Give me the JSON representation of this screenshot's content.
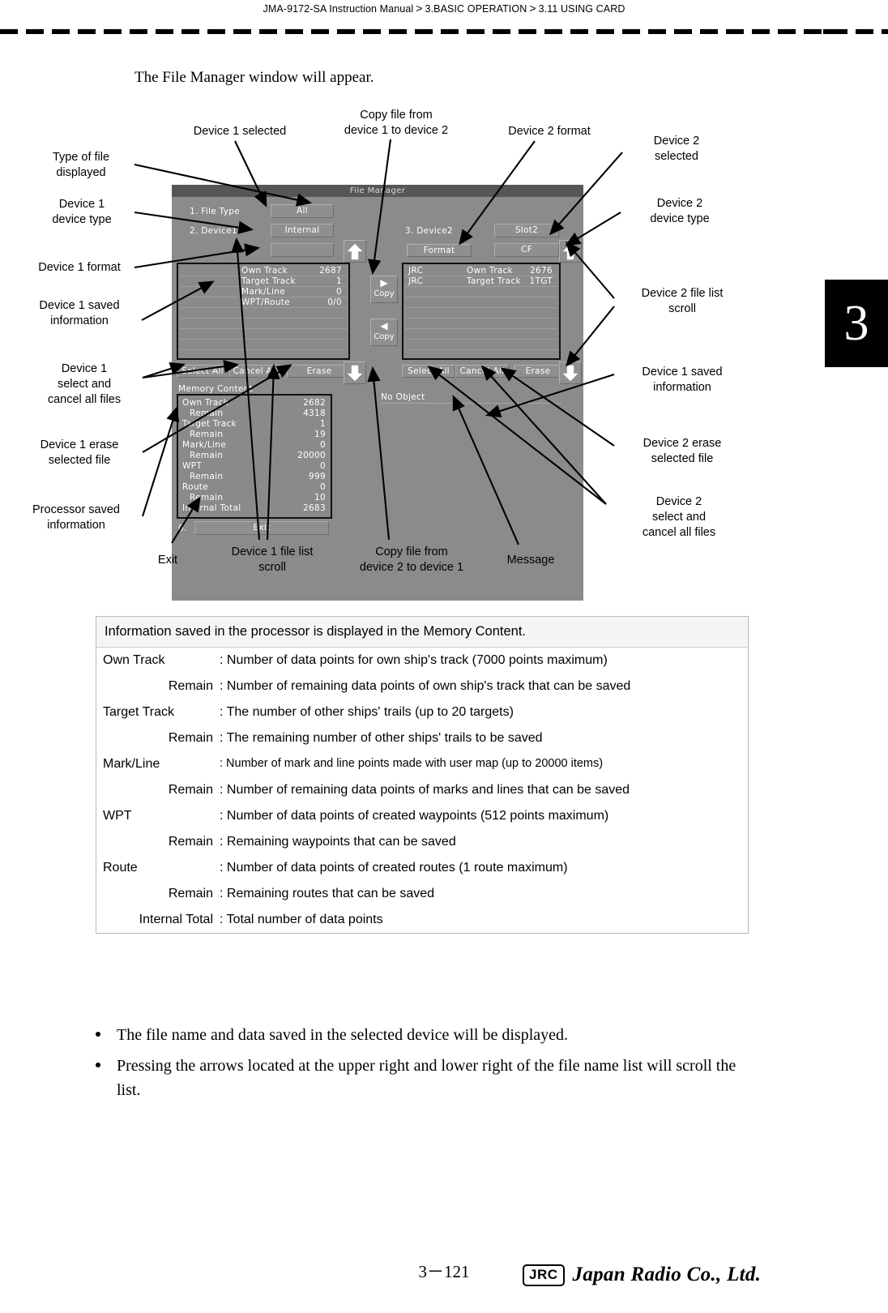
{
  "header": {
    "manual": "JMA-9172-SA Instruction Manual",
    "sep1": ">",
    "chapter": "3.BASIC OPERATION",
    "sep2": ">",
    "section": "3.11  USING CARD",
    "chapter_tab": "3"
  },
  "intro": "The File Manager window will appear.",
  "figure": {
    "callouts": {
      "type_of_file": "Type of file\ndisplayed",
      "device1_type": "Device 1\ndevice type",
      "device1_format": "Device 1 format",
      "device1_saved": "Device 1 saved\ninformation",
      "device1_selectcancel": "Device 1\nselect and\ncancel all files",
      "device1_erase": "Device 1 erase\nselected file",
      "processor_saved": "Processor saved\ninformation",
      "device1_selected": "Device 1 selected",
      "copy_1_to_2": "Copy file from\ndevice 1 to device 2",
      "device2_format": "Device 2 format",
      "device2_selected": "Device 2\nselected",
      "device2_type": "Device 2\ndevice type",
      "device2_scroll": "Device 2 file list\nscroll",
      "device1_saved_right": "Device 1 saved\ninformation",
      "device2_erase": "Device 2 erase\nselected file",
      "device2_selectcancel": "Device 2\nselect and\ncancel all files",
      "exit": "Exit",
      "device1_scroll": "Device 1 file list\nscroll",
      "copy_2_to_1": "Copy file from\ndevice 2 to device 1",
      "message": "Message"
    }
  },
  "dialog": {
    "title": "File  Manager",
    "left": {
      "item1_label": "1.  File  Type",
      "item1_value": "All",
      "item2_label": "2.  Device1",
      "item2_value": "Internal",
      "format_value": "",
      "list": [
        {
          "name": "",
          "item": "Own  Track",
          "value": "2687"
        },
        {
          "name": "",
          "item": "Target  Track",
          "value": "1"
        },
        {
          "name": "",
          "item": "Mark/Line",
          "value": "0"
        },
        {
          "name": "",
          "item": "WPT/Route",
          "value": "0/0"
        }
      ],
      "select_all": "Select  All",
      "cancel_all": "Cancel  All",
      "erase": "Erase"
    },
    "right": {
      "item3_label": "3.  Device2",
      "item3_value": "Slot2",
      "format_label": "Format",
      "media_value": "CF",
      "list": [
        {
          "name": "JRC",
          "item": "Own  Track",
          "value": "2676"
        },
        {
          "name": "JRC",
          "item": "Target  Track",
          "value": "1TGT"
        }
      ],
      "select_all": "Select  All",
      "cancel_all": "Cancel  All",
      "erase": "Erase",
      "message": "No  Object"
    },
    "copy_right_label": "Copy",
    "copy_left_label": "Copy",
    "copy_right_glyph": "▶",
    "copy_left_glyph": "◀",
    "memory_caption": "Memory  Content",
    "memory": [
      {
        "key": "Own  Track",
        "indent": false,
        "value": "2682"
      },
      {
        "key": "Remain",
        "indent": true,
        "value": "4318"
      },
      {
        "key": "Target  Track",
        "indent": false,
        "value": "1"
      },
      {
        "key": "Remain",
        "indent": true,
        "value": "19"
      },
      {
        "key": "Mark/Line",
        "indent": false,
        "value": "0"
      },
      {
        "key": "Remain",
        "indent": true,
        "value": "20000"
      },
      {
        "key": "WPT",
        "indent": false,
        "value": "0"
      },
      {
        "key": "Remain",
        "indent": true,
        "value": "999"
      },
      {
        "key": "Route",
        "indent": false,
        "value": "0"
      },
      {
        "key": "Remain",
        "indent": true,
        "value": "10"
      },
      {
        "key": "Internal  Total",
        "indent": false,
        "value": "2683"
      }
    ],
    "exit_index": "0.",
    "exit_label": "Exit"
  },
  "desc_table": {
    "header": "Information saved in the processor is displayed in the Memory Content.",
    "rows": [
      {
        "term": "Own Track",
        "indent": false,
        "desc": ": Number of data points for own ship's track (7000 points maximum)",
        "small": false
      },
      {
        "term": "Remain",
        "indent": true,
        "desc": ": Number of remaining data points of own ship's track that can be saved",
        "small": false
      },
      {
        "term": "Target Track",
        "indent": false,
        "desc": ": The number of other ships' trails (up to 20 targets)",
        "small": false
      },
      {
        "term": "Remain",
        "indent": true,
        "desc": ": The remaining number of other ships' trails to be saved",
        "small": false
      },
      {
        "term": "Mark/Line",
        "indent": false,
        "desc": ": Number of mark and line points made with user map (up to 20000 items)",
        "small": true
      },
      {
        "term": "Remain",
        "indent": true,
        "desc": ": Number of remaining data points of marks and lines that can be saved",
        "small": false
      },
      {
        "term": "WPT",
        "indent": false,
        "desc": ": Number of data points of created waypoints (512 points maximum)",
        "small": false
      },
      {
        "term": "Remain",
        "indent": true,
        "desc": ": Remaining waypoints that can be saved",
        "small": false
      },
      {
        "term": "Route",
        "indent": false,
        "desc": ": Number of data points of created routes (1 route maximum)",
        "small": false
      },
      {
        "term": "Remain",
        "indent": true,
        "desc": ": Remaining routes that can be saved",
        "small": false
      },
      {
        "term": "Internal Total",
        "indent": true,
        "desc": ": Total number of data points",
        "small": false
      }
    ]
  },
  "bullets": [
    "The file name and data saved in the selected device will be displayed.",
    "Pressing the arrows located at the upper right and lower right of the file name list will scroll the list."
  ],
  "footer": {
    "page": "3－121",
    "logo_mark": "JRC",
    "logo_name": "Japan Radio Co., Ltd."
  }
}
